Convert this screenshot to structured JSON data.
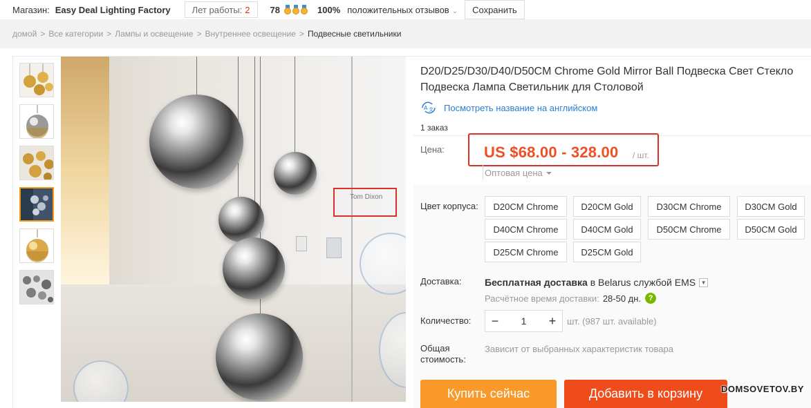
{
  "store": {
    "label": "Магазин:",
    "name": "Easy Deal Lighting Factory",
    "years_label": "Лет работы:",
    "years_value": "2",
    "score": "78",
    "positive_pct": "100%",
    "positive_label": "положительных отзывов",
    "save_label": "Сохранить"
  },
  "breadcrumb": [
    "домой",
    "Все категории",
    "Лампы и освещение",
    "Внутреннее освещение",
    "Подвесные светильники"
  ],
  "gallery": {
    "thumbnails": [
      {
        "kind": "gold-balls"
      },
      {
        "kind": "chrome-gold-ball"
      },
      {
        "kind": "gold-balls-dark"
      },
      {
        "kind": "chrome-balls-blue",
        "active": true
      },
      {
        "kind": "gold-ball"
      },
      {
        "kind": "chrome-balls-gray"
      }
    ],
    "image_brand": "Tom Dixon"
  },
  "product": {
    "title": "D20/D25/D30/D40/D50CM Chrome Gold Mirror Ball Подвеска Свет Стекло Подвеска Лампа Светильник для Столовой",
    "english_link": "Посмотреть название на английском",
    "orders": "1 заказ",
    "price_label": "Цена:",
    "price": "US $68.00 - 328.00",
    "price_unit": "/ шт.",
    "wholesale": "Оптовая цена",
    "color_label": "Цвет корпуса:",
    "colors": [
      "D20CM Chrome",
      "D20CM Gold",
      "D30CM Chrome",
      "D30CM Gold",
      "D40CM Chrome",
      "D40CM Gold",
      "D50CM Chrome",
      "D50CM Gold",
      "D25CM Chrome",
      "D25CM Gold"
    ],
    "shipping_label": "Доставка:",
    "shipping_free": "Бесплатная доставка",
    "shipping_to": "в Belarus службой EMS",
    "eta_label": "Расчётное время доставки:",
    "eta_value": "28-50 дн.",
    "qty_label": "Количество:",
    "qty_value": "1",
    "qty_available": "шт. (987 шт. available)",
    "total_label": "Общая стоимость:",
    "total_value": "Зависит от выбранных характеристик товара",
    "buy_now": "Купить сейчас",
    "add_to_cart": "Добавить в корзину"
  },
  "watermark": "DOMSOVETOV.BY",
  "colors": {
    "price": "#f04e23",
    "link": "#2a7ed3",
    "buy": "#f8992a",
    "cart": "#ee4d1b",
    "highlight_box": "#d9302a",
    "active_thumb": "#f39c12",
    "help": "#7ab800"
  }
}
